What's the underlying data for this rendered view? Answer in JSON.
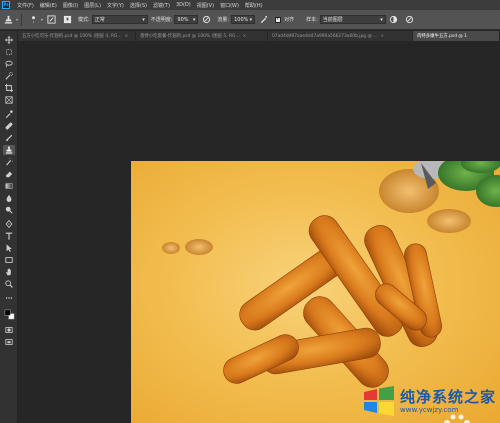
{
  "app": {
    "logo_text": "Ps"
  },
  "menubar": {
    "items": [
      "文件(F)",
      "编辑(E)",
      "图像(I)",
      "图层(L)",
      "文字(Y)",
      "选择(S)",
      "滤镜(T)",
      "3D(D)",
      "视图(V)",
      "窗口(W)",
      "帮助(H)"
    ]
  },
  "options": {
    "mode_label": "模式:",
    "mode_value": "正常",
    "opacity_label": "不透明度:",
    "opacity_value": "90%",
    "flow_label": "流量:",
    "flow_value": "100%",
    "align_label": "对齐",
    "aligned_checked": true,
    "sample_label": "样本:",
    "sample_value": "当前图层"
  },
  "tabs": [
    {
      "label": "五方小吃可乐-炸翅的.psd @ 100% (图层 4, RG...",
      "active": false
    },
    {
      "label": "香馋小吃套餐-炸翅的.psd @ 100% (图层 5, RG...",
      "active": false
    },
    {
      "label": "07ad4dd97aae4d47a990a566273a60b.jpg @ ...",
      "active": false
    },
    {
      "label": "肉特多嫩牛五方.psd @ 1",
      "active": true
    }
  ],
  "toolbar": {
    "tools": [
      "move-tool",
      "artboard-tool",
      "lasso-tool",
      "quick-select-tool",
      "crop-tool",
      "frame-tool",
      "eyedropper-tool",
      "healing-brush-tool",
      "brush-tool",
      "clone-stamp-tool",
      "history-brush-tool",
      "eraser-tool",
      "gradient-tool",
      "blur-tool",
      "dodge-tool",
      "pen-tool",
      "type-tool",
      "path-select-tool",
      "rectangle-tool",
      "hand-tool",
      "zoom-tool",
      "more-tools",
      "foreground-background-colors",
      "quick-mask",
      "screen-mode"
    ]
  },
  "watermark": {
    "title": "纯净系统之家",
    "url": "www.ycwjzy.com"
  },
  "colors": {
    "menubar_bg": "#3c3c3c",
    "optionsbar_bg": "#535353",
    "panel_bg": "#323232",
    "workspace_bg": "#262626",
    "canvas_accent": "#f2bd4f",
    "watermark_blue": "#1e5aa8"
  }
}
